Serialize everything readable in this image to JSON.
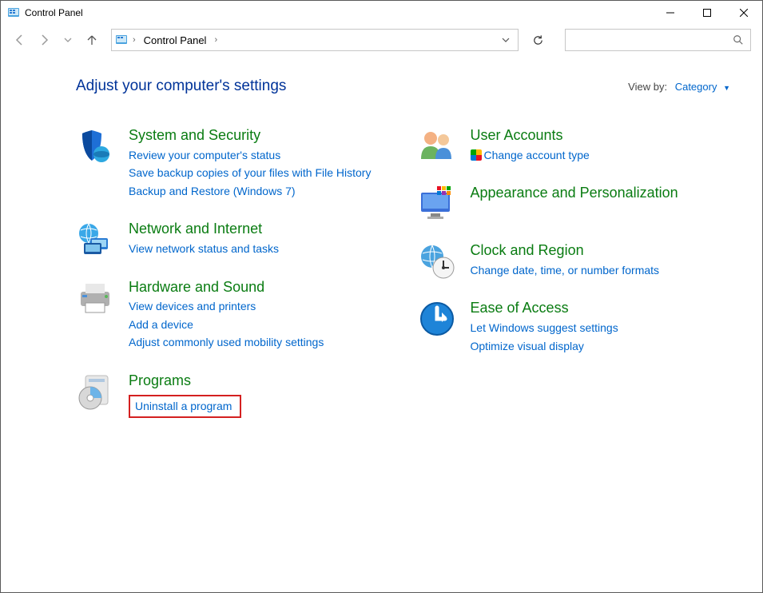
{
  "window": {
    "title": "Control Panel"
  },
  "breadcrumb": {
    "root": "Control Panel"
  },
  "search": {
    "placeholder": ""
  },
  "header": {
    "heading": "Adjust your computer's settings",
    "view_by_label": "View by:",
    "view_by_value": "Category"
  },
  "left_col": [
    {
      "id": "system-security",
      "title": "System and Security",
      "links": [
        {
          "text": "Review your computer's status"
        },
        {
          "text": "Save backup copies of your files with File History"
        },
        {
          "text": "Backup and Restore (Windows 7)"
        }
      ]
    },
    {
      "id": "network-internet",
      "title": "Network and Internet",
      "links": [
        {
          "text": "View network status and tasks"
        }
      ]
    },
    {
      "id": "hardware-sound",
      "title": "Hardware and Sound",
      "links": [
        {
          "text": "View devices and printers"
        },
        {
          "text": "Add a device"
        },
        {
          "text": "Adjust commonly used mobility settings"
        }
      ]
    },
    {
      "id": "programs",
      "title": "Programs",
      "links": [
        {
          "text": "Uninstall a program",
          "highlighted": true
        }
      ]
    }
  ],
  "right_col": [
    {
      "id": "user-accounts",
      "title": "User Accounts",
      "links": [
        {
          "text": "Change account type",
          "shield": true
        }
      ]
    },
    {
      "id": "appearance-personalization",
      "title": "Appearance and Personalization",
      "links": []
    },
    {
      "id": "clock-region",
      "title": "Clock and Region",
      "links": [
        {
          "text": "Change date, time, or number formats"
        }
      ]
    },
    {
      "id": "ease-of-access",
      "title": "Ease of Access",
      "links": [
        {
          "text": "Let Windows suggest settings"
        },
        {
          "text": "Optimize visual display"
        }
      ]
    }
  ]
}
